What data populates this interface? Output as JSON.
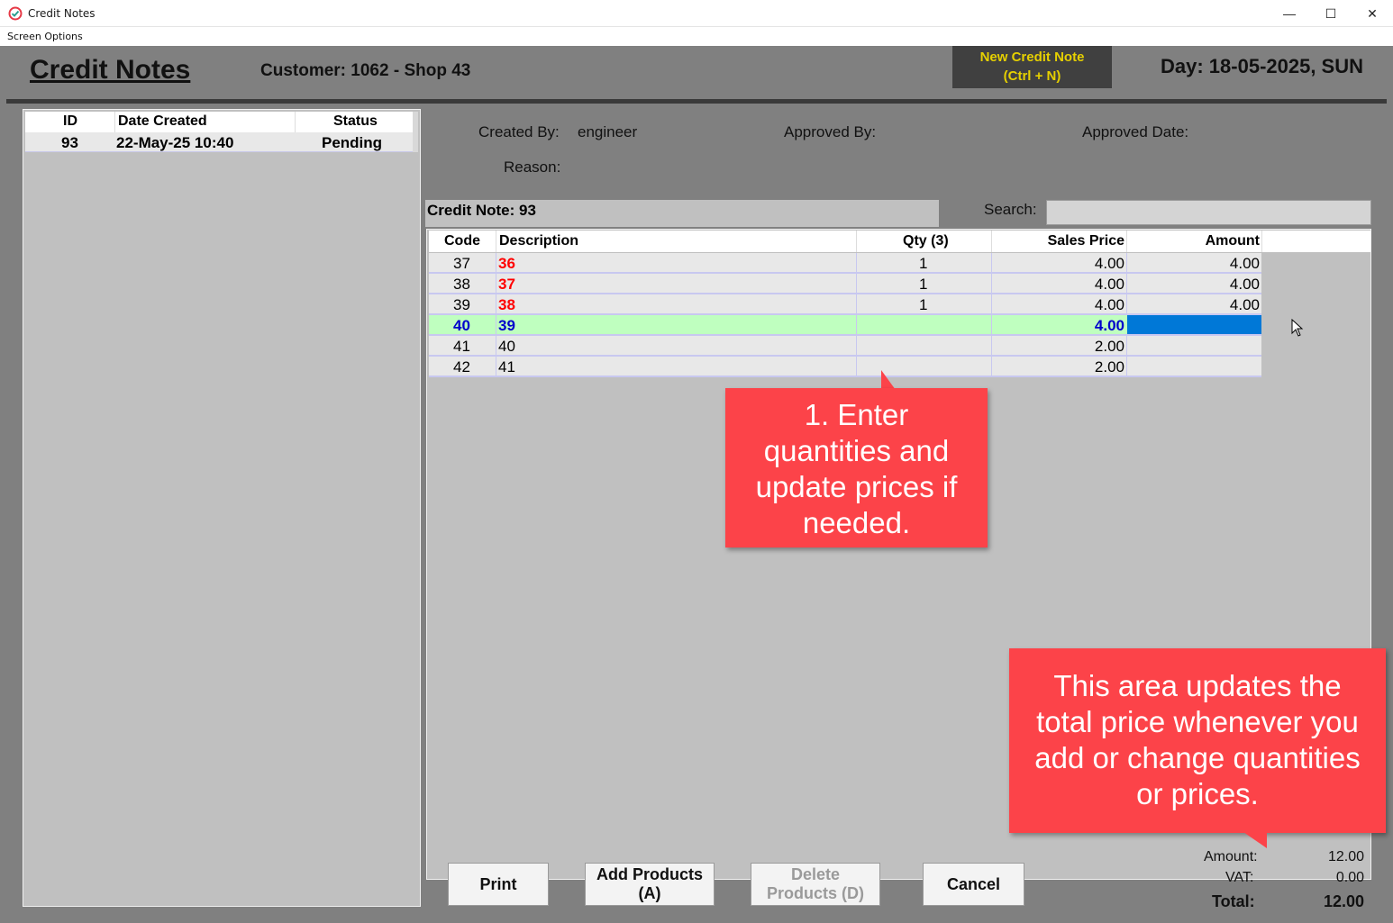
{
  "window": {
    "title": "Credit Notes",
    "minimize": "—",
    "maximize": "☐",
    "close": "✕"
  },
  "menu": {
    "screen_options": "Screen Options"
  },
  "header": {
    "title": "Credit Notes",
    "customer": "Customer: 1062 - Shop 43",
    "new_button_line1": "New Credit Note",
    "new_button_line2": "(Ctrl + N)",
    "day": "Day: 18-05-2025, SUN"
  },
  "credit_list": {
    "columns": [
      "ID",
      "Date Created",
      "Status"
    ],
    "rows": [
      {
        "id": "93",
        "date": "22-May-25 10:40",
        "status": "Pending"
      }
    ]
  },
  "info": {
    "created_by_label": "Created By:",
    "created_by_value": "engineer",
    "approved_by_label": "Approved By:",
    "approved_date_label": "Approved Date:",
    "reason_label": "Reason:"
  },
  "credit_note_label": "Credit Note: 93",
  "search": {
    "label": "Search:",
    "value": ""
  },
  "products": {
    "columns": [
      "Code",
      "Description",
      "Qty (3)",
      "Sales Price",
      "Amount"
    ],
    "rows": [
      {
        "code": "37",
        "desc": "36",
        "qty": "1",
        "price": "4.00",
        "amount": "4.00"
      },
      {
        "code": "38",
        "desc": "37",
        "qty": "1",
        "price": "4.00",
        "amount": "4.00"
      },
      {
        "code": "39",
        "desc": "38",
        "qty": "1",
        "price": "4.00",
        "amount": "4.00"
      },
      {
        "code": "40",
        "desc": "39",
        "qty": "",
        "price": "4.00",
        "amount": ""
      },
      {
        "code": "41",
        "desc": "40",
        "qty": "",
        "price": "2.00",
        "amount": ""
      },
      {
        "code": "42",
        "desc": "41",
        "qty": "",
        "price": "2.00",
        "amount": ""
      }
    ]
  },
  "callouts": {
    "step1_line1": "1. Enter",
    "step1_line2": "quantities and",
    "step1_line3": "update prices if",
    "step1_line4": "needed.",
    "total_line1": "This area updates the",
    "total_line2": "total price whenever you",
    "total_line3": "add or change quantities",
    "total_line4": "or prices."
  },
  "buttons": {
    "print": "Print",
    "add_line1": "Add Products",
    "add_line2": "(A)",
    "delete_line1": "Delete",
    "delete_line2": "Products (D)",
    "cancel": "Cancel"
  },
  "totals": {
    "amount_label": "Amount:",
    "amount_value": "12.00",
    "vat_label": "VAT:",
    "vat_value": "0.00",
    "total_label": "Total:",
    "total_value": "12.00"
  },
  "colors": {
    "callout": "#fc4349",
    "selected_row": "#bfffbf",
    "selection_blue": "#0078d7",
    "new_button_text": "#e6d000"
  }
}
